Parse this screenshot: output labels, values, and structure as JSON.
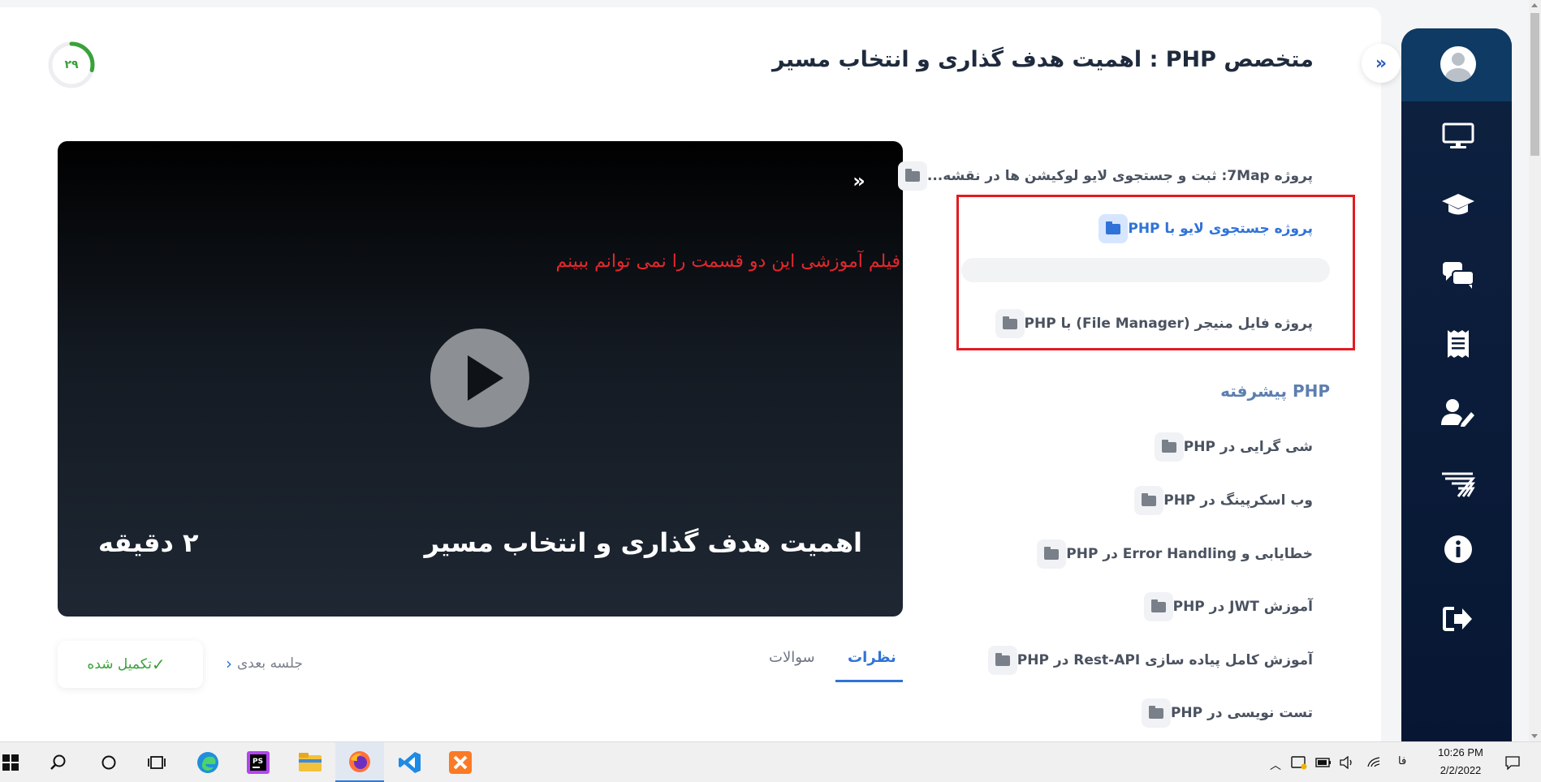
{
  "header": {
    "title": "متخصص PHP : اهمیت هدف گذاری و انتخاب مسیر",
    "progress": "۲۹",
    "progress_fraction": 0.29
  },
  "video": {
    "note": "فیلم آموزشی این دو قسمت را نمی توانم ببینم",
    "title": "اهمیت هدف گذاری و انتخاب مسیر",
    "duration": "۲ دقیقه"
  },
  "lessons": [
    {
      "label": "پروژه 7Map: ثبت و جستجوی لایو لوکیشن ها در نقشه...",
      "active": false
    },
    {
      "label": "پروژه جستجوی لایو با PHP",
      "active": true
    },
    {
      "label": "پروژه فایل منیجر (File Manager) با PHP",
      "active": false
    }
  ],
  "section": {
    "title": "PHP پیشرفته"
  },
  "section_lessons": [
    {
      "label": "شی گرایی در PHP"
    },
    {
      "label": "وب اسکرپینگ در PHP"
    },
    {
      "label": "خطایابی و Error Handling در PHP"
    },
    {
      "label": "آموزش JWT در PHP"
    },
    {
      "label": "آموزش کامل پیاده سازی Rest-API در PHP"
    },
    {
      "label": "تست نویسی در PHP"
    }
  ],
  "controls": {
    "complete_label": "تکمیل شده",
    "next_label": "جلسه بعدی",
    "tab_comments": "نظرات",
    "tab_questions": "سوالات"
  },
  "sidebar_icons": [
    "monitor-icon",
    "graduation-cap-icon",
    "chat-icon",
    "receipt-icon",
    "user-edit-icon",
    "stacks-icon",
    "info-icon",
    "sign-out-icon"
  ],
  "taskbar": {
    "lang": "فا",
    "time": "10:26 PM",
    "date": "2/2/2022"
  },
  "colors": {
    "accent": "#2f73d8",
    "success": "#3aa13a",
    "sidebar": "#0a1c3a",
    "highlight": "#e31b22"
  }
}
